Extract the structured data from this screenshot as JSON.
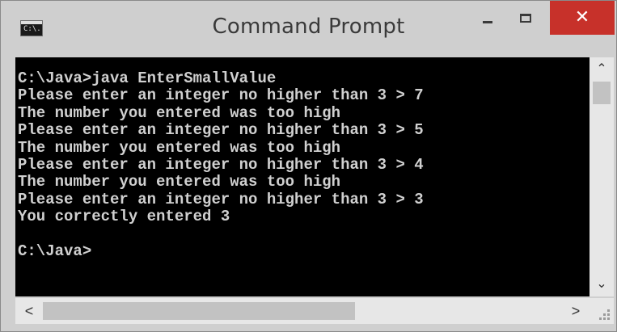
{
  "window": {
    "title": "Command Prompt",
    "icon_text": "C:\\."
  },
  "controls": {
    "minimize": "minimize",
    "maximize": "maximize",
    "close": "✕"
  },
  "console": {
    "lines": [
      "C:\\Java>java EnterSmallValue",
      "Please enter an integer no higher than 3 > 7",
      "The number you entered was too high",
      "Please enter an integer no higher than 3 > 5",
      "The number you entered was too high",
      "Please enter an integer no higher than 3 > 4",
      "The number you entered was too high",
      "Please enter an integer no higher than 3 > 3",
      "You correctly entered 3",
      "",
      "C:\\Java>"
    ]
  },
  "scrollbars": {
    "up_arrow": "⌃",
    "down_arrow": "⌄",
    "left_arrow": "<",
    "right_arrow": ">"
  }
}
